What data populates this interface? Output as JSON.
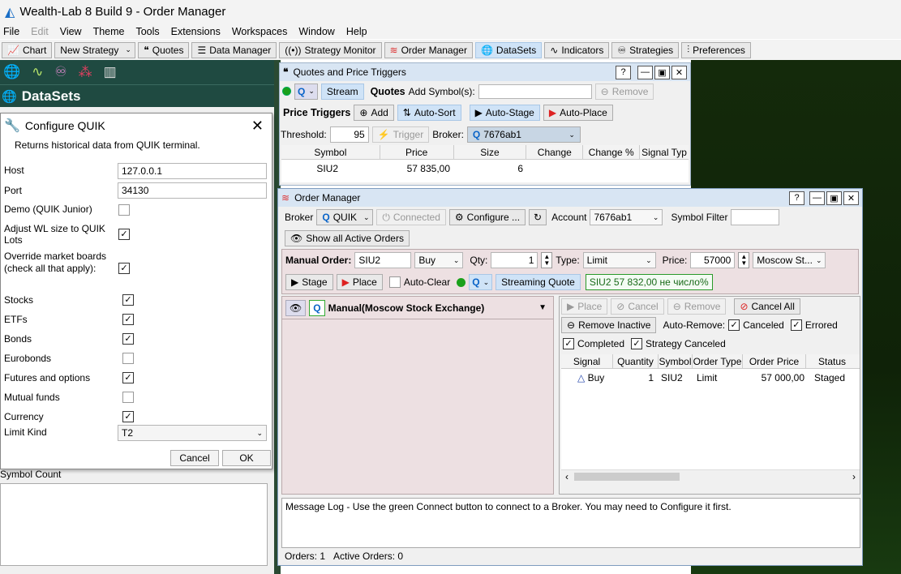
{
  "app": {
    "title": "Wealth-Lab 8 Build 9 - Order Manager"
  },
  "menu": [
    "File",
    "Edit",
    "View",
    "Theme",
    "Tools",
    "Extensions",
    "Workspaces",
    "Window",
    "Help"
  ],
  "toolbar": {
    "chart": "Chart",
    "new_strategy": "New Strategy",
    "quotes": "Quotes",
    "data_manager": "Data Manager",
    "strategy_monitor": "Strategy Monitor",
    "order_manager": "Order Manager",
    "datasets": "DataSets",
    "indicators": "Indicators",
    "strategies": "Strategies",
    "preferences": "Preferences"
  },
  "datasets_panel": {
    "title": "DataSets",
    "symbol_count_label": "Symbol Count"
  },
  "configure": {
    "title": "Configure QUIK",
    "description": "Returns historical data from QUIK terminal.",
    "host_label": "Host",
    "host_value": "127.0.0.1",
    "port_label": "Port",
    "port_value": "34130",
    "demo_label": "Demo (QUIK Junior)",
    "adjust_label": "Adjust WL size to QUIK Lots",
    "override_label": "Override market boards (check all that apply):",
    "boards": [
      {
        "label": "Stocks",
        "checked": true
      },
      {
        "label": "ETFs",
        "checked": true
      },
      {
        "label": "Bonds",
        "checked": true
      },
      {
        "label": "Eurobonds",
        "checked": false
      },
      {
        "label": "Futures and options",
        "checked": true
      },
      {
        "label": "Mutual funds",
        "checked": false
      },
      {
        "label": "Currency",
        "checked": true
      }
    ],
    "limit_label": "Limit Kind",
    "limit_value": "T2",
    "cancel": "Cancel",
    "ok": "OK"
  },
  "quotes": {
    "title": "Quotes and Price Triggers",
    "stream": "Stream",
    "quotes_label": "Quotes",
    "add_symbols": "Add Symbol(s):",
    "remove": "Remove",
    "price_triggers": "Price Triggers",
    "add": "Add",
    "auto_sort": "Auto-Sort",
    "auto_stage": "Auto-Stage",
    "auto_place": "Auto-Place",
    "threshold_label": "Threshold:",
    "threshold_value": "95",
    "trigger": "Trigger",
    "broker_label": "Broker:",
    "broker_value": "7676ab1",
    "columns": [
      "Symbol",
      "Price",
      "Size",
      "Change",
      "Change %",
      "Signal Typ"
    ],
    "rows": [
      {
        "symbol": "SIU2",
        "price": "57 835,00",
        "size": "6",
        "change": "",
        "change_pct": "",
        "signal": ""
      }
    ]
  },
  "order_manager": {
    "title": "Order Manager",
    "broker_label": "Broker",
    "broker_value": "QUIK",
    "connected": "Connected",
    "configure": "Configure ...",
    "account_label": "Account",
    "account_value": "7676ab1",
    "symbol_filter": "Symbol Filter",
    "show_all": "Show all Active Orders",
    "manual_order": "Manual Order:",
    "symbol_value": "SIU2",
    "side_value": "Buy",
    "qty_label": "Qty:",
    "qty_value": "1",
    "type_label": "Type:",
    "type_value": "Limit",
    "price_label": "Price:",
    "price_value": "57000",
    "exchange_value": "Moscow St...",
    "stage": "Stage",
    "place": "Place",
    "auto_clear": "Auto-Clear",
    "streaming_quote": "Streaming Quote",
    "quote_text": "SIU2 57 832,00 не число%",
    "account_tree": "Manual(Moscow Stock Exchange)",
    "place_btn": "Place",
    "cancel_btn": "Cancel",
    "remove_btn": "Remove",
    "cancel_all": "Cancel All",
    "remove_inactive": "Remove Inactive",
    "auto_remove": "Auto-Remove:",
    "canceled": "Canceled",
    "errored": "Errored",
    "completed": "Completed",
    "strategy_canceled": "Strategy Canceled",
    "columns": [
      "Signal",
      "Quantity",
      "Symbol",
      "Order Type",
      "Order Price",
      "Status"
    ],
    "orders": [
      {
        "signal": "Buy",
        "quantity": "1",
        "symbol": "SIU2",
        "type": "Limit",
        "price": "57 000,00",
        "status": "Staged"
      }
    ],
    "message_log": "Message Log - Use the green Connect button to connect to a Broker. You may need to Configure it first.",
    "orders_count": "Orders: 1",
    "active_orders": "Active Orders: 0"
  },
  "colors": {
    "datasets_bg": "#1f4a41",
    "chart_bg": "#152b0c",
    "titlebar": "#d8e5f3",
    "accent": "#0078d4"
  }
}
